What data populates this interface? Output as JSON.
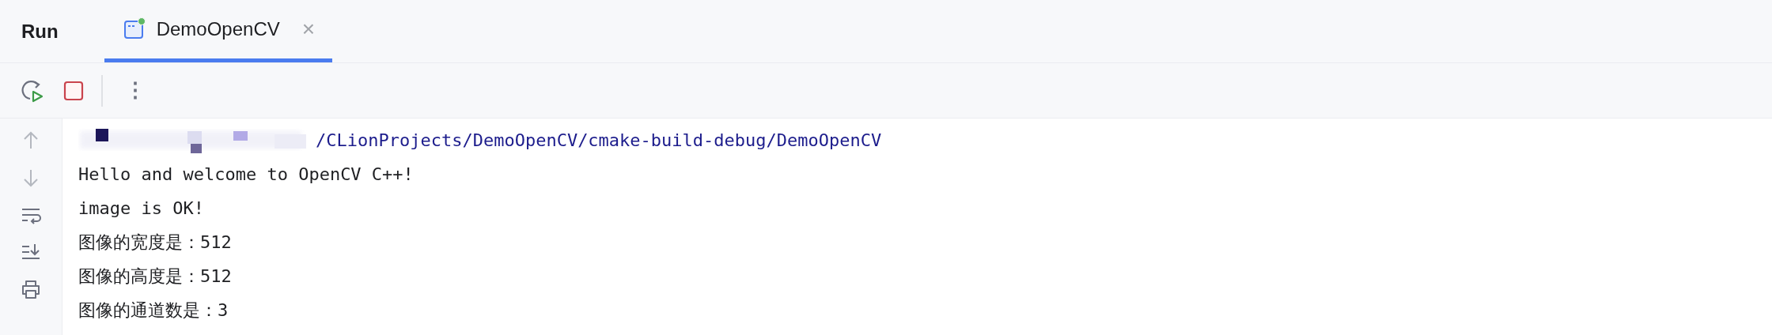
{
  "panel_title": "Run",
  "tabs": [
    {
      "label": "DemoOpenCV",
      "selected": true,
      "running": true,
      "close": "×"
    }
  ],
  "toolbar": {
    "more": "⋮"
  },
  "console": {
    "lines": [
      {
        "kind": "path",
        "text": "/CLionProjects/DemoOpenCV/cmake-build-debug/DemoOpenCV",
        "redacted": true
      },
      {
        "kind": "output",
        "text": "Hello and welcome to OpenCV C++!"
      },
      {
        "kind": "output",
        "text": "image is OK!"
      },
      {
        "kind": "output",
        "text": "图像的宽度是：512"
      },
      {
        "kind": "output",
        "text": "图像的高度是：512"
      },
      {
        "kind": "output",
        "text": "图像的通道数是：3"
      }
    ]
  }
}
